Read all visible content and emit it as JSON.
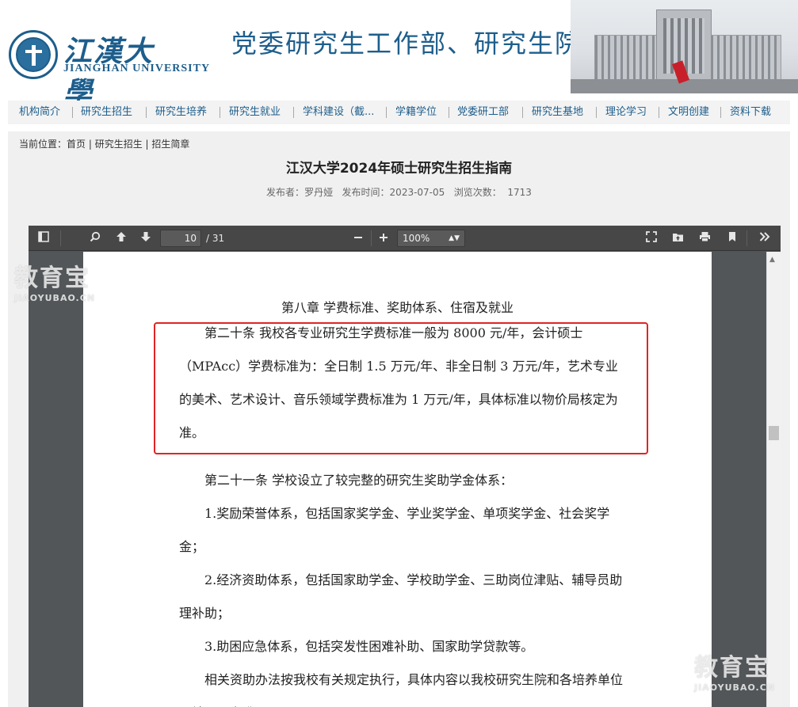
{
  "header": {
    "logo_cn": "江漢大學",
    "logo_en": "JIANGHAN UNIVERSITY",
    "site_title": "党委研究生工作部、研究生院"
  },
  "nav": {
    "items": [
      "机构简介",
      "研究生招生",
      "研究生培养",
      "研究生就业",
      "学科建设（截...",
      "学籍学位",
      "党委研工部",
      "研究生基地",
      "理论学习",
      "文明创建",
      "资料下载"
    ]
  },
  "breadcrumb": {
    "label": "当前位置：",
    "trail": "首页 | 研究生招生 | 招生简章"
  },
  "article": {
    "title": "江汉大学2024年硕士研究生招生指南",
    "publisher_label": "发布者：",
    "publisher": "罗丹娅",
    "date_label": "发布时间：",
    "date": "2023-07-05",
    "views_label": "浏览次数：",
    "views": "1713"
  },
  "viewer": {
    "page_current": "10",
    "page_total": "/ 31",
    "zoom": "100%",
    "icons": {
      "sidebar": "sidebar-toggle-icon",
      "search": "search-icon",
      "prev": "arrow-up-icon",
      "next": "arrow-down-icon",
      "zoom_out": "minus-icon",
      "zoom_in": "plus-icon",
      "fullscreen": "fullscreen-icon",
      "open": "open-file-icon",
      "print": "print-icon",
      "bookmark": "bookmark-icon",
      "more": "double-chevron-right-icon"
    }
  },
  "pdf": {
    "chapter": "第八章  学费标准、奖助体系、住宿及就业",
    "article20": "第二十条 我校各专业研究生学费标准一般为 8000 元/年，会计硕士（MPAcc）学费标准为：全日制 1.5 万元/年、非全日制 3 万元/年，艺术专业的美术、艺术设计、音乐领域学费标准为 1 万元/年，具体标准以物价局核定为准。",
    "article21": "第二十一条 学校设立了较完整的研究生奖助学金体系：",
    "item1": "1.奖励荣誉体系，包括国家奖学金、学业奖学金、单项奖学金、社会奖学金；",
    "item2": "2.经济资助体系，包括国家助学金、学校助学金、三助岗位津贴、辅导员助理补助；",
    "item3": "3.助困应急体系，包括突发性困难补助、国家助学贷款等。",
    "closing": "相关资助办法按我校有关规定执行，具体内容以我校研究生院和各培养单位网站公示为准。"
  },
  "watermark": {
    "cn": "教育宝",
    "en": "JIAOYUBAO.CN"
  },
  "colors": {
    "brand_blue": "#1d5e8c",
    "highlight_red": "#e02424",
    "toolbar_dark": "#474747"
  }
}
